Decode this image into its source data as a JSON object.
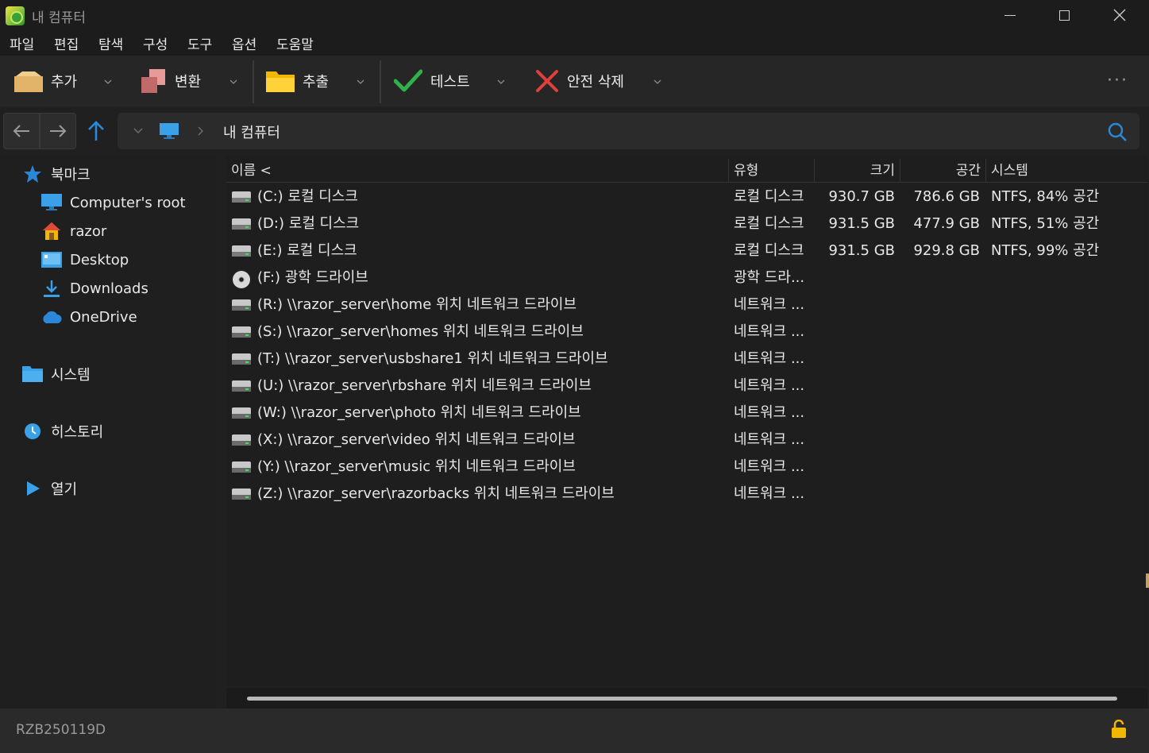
{
  "window": {
    "title": "내 컴퓨터"
  },
  "menu": [
    "파일",
    "편집",
    "탐색",
    "구성",
    "도구",
    "옵션",
    "도움말"
  ],
  "toolbar": {
    "add": "추가",
    "convert": "변환",
    "extract": "추출",
    "test": "테스트",
    "secure_delete": "안전 삭제",
    "more": "···"
  },
  "address": {
    "path": "내 컴퓨터"
  },
  "sidebar": {
    "bookmarks_label": "북마크",
    "items": [
      {
        "label": "Computer's root",
        "icon": "monitor-icon"
      },
      {
        "label": "razor",
        "icon": "home-icon"
      },
      {
        "label": "Desktop",
        "icon": "desktop-icon"
      },
      {
        "label": "Downloads",
        "icon": "download-icon"
      },
      {
        "label": "OneDrive",
        "icon": "cloud-icon"
      }
    ],
    "system_label": "시스템",
    "history_label": "히스토리",
    "open_label": "열기"
  },
  "columns": {
    "name": "이름 <",
    "type": "유형",
    "size": "크기",
    "free": "공간",
    "fs": "시스템"
  },
  "drives": [
    {
      "name": "(C:) 로컬 디스크",
      "type": "로컬 디스크",
      "size": "930.7 GB",
      "free": "786.6 GB",
      "fs": "NTFS, 84% 공간",
      "icon": "hard-drive-icon"
    },
    {
      "name": "(D:) 로컬 디스크",
      "type": "로컬 디스크",
      "size": "931.5 GB",
      "free": "477.9 GB",
      "fs": "NTFS, 51% 공간",
      "icon": "hard-drive-icon"
    },
    {
      "name": "(E:) 로컬 디스크",
      "type": "로컬 디스크",
      "size": "931.5 GB",
      "free": "929.8 GB",
      "fs": "NTFS, 99% 공간",
      "icon": "hard-drive-icon"
    },
    {
      "name": "(F:) 광학 드라이브",
      "type": "광학 드라...",
      "size": "",
      "free": "",
      "fs": "",
      "icon": "optical-drive-icon"
    },
    {
      "name": "(R:) \\\\razor_server\\home 위치 네트워크 드라이브",
      "type": "네트워크 ...",
      "size": "",
      "free": "",
      "fs": "",
      "icon": "network-drive-icon"
    },
    {
      "name": "(S:) \\\\razor_server\\homes 위치 네트워크 드라이브",
      "type": "네트워크 ...",
      "size": "",
      "free": "",
      "fs": "",
      "icon": "network-drive-icon"
    },
    {
      "name": "(T:) \\\\razor_server\\usbshare1 위치 네트워크 드라이브",
      "type": "네트워크 ...",
      "size": "",
      "free": "",
      "fs": "",
      "icon": "network-drive-icon"
    },
    {
      "name": "(U:) \\\\razor_server\\rbshare 위치 네트워크 드라이브",
      "type": "네트워크 ...",
      "size": "",
      "free": "",
      "fs": "",
      "icon": "network-drive-icon"
    },
    {
      "name": "(W:) \\\\razor_server\\photo 위치 네트워크 드라이브",
      "type": "네트워크 ...",
      "size": "",
      "free": "",
      "fs": "",
      "icon": "network-drive-icon"
    },
    {
      "name": "(X:) \\\\razor_server\\video 위치 네트워크 드라이브",
      "type": "네트워크 ...",
      "size": "",
      "free": "",
      "fs": "",
      "icon": "network-drive-icon"
    },
    {
      "name": "(Y:) \\\\razor_server\\music 위치 네트워크 드라이브",
      "type": "네트워크 ...",
      "size": "",
      "free": "",
      "fs": "",
      "icon": "network-drive-icon"
    },
    {
      "name": "(Z:) \\\\razor_server\\razorbacks 위치 네트워크 드라이브",
      "type": "네트워크 ...",
      "size": "",
      "free": "",
      "fs": "",
      "icon": "network-drive-icon"
    }
  ],
  "status": {
    "text": "RZB250119D"
  },
  "colors": {
    "accent": "#2b88d8",
    "background": "#202020",
    "test_green": "#2fb24a",
    "delete_red": "#e0403a"
  }
}
